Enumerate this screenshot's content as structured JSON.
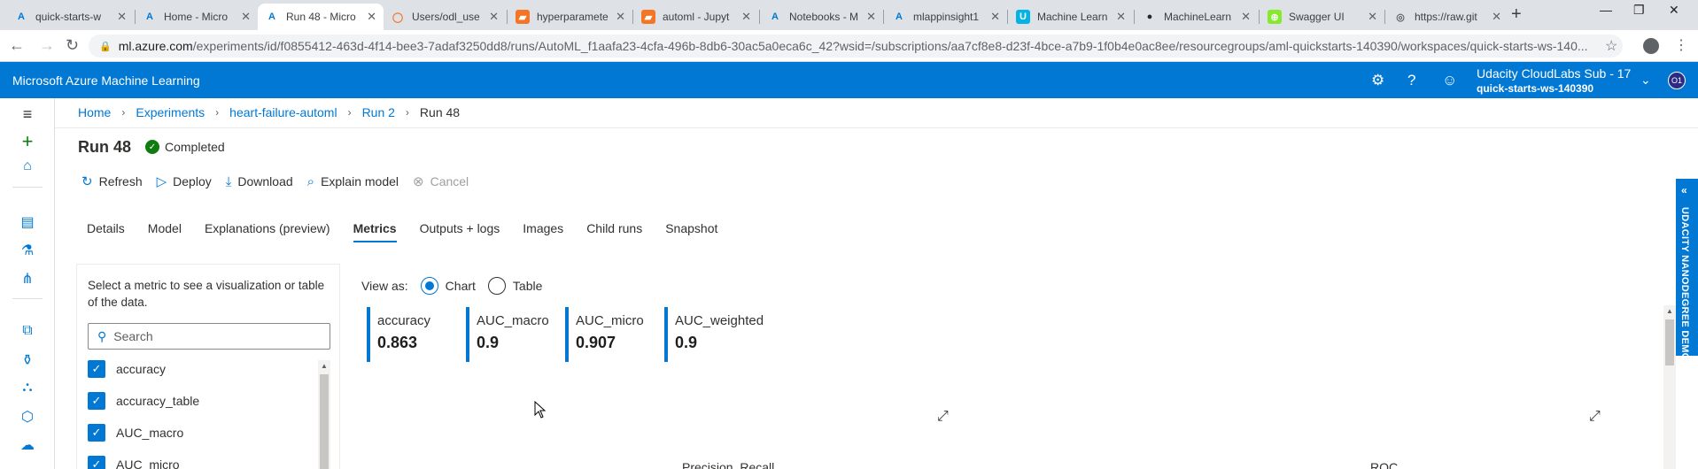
{
  "browser": {
    "tabs": [
      {
        "label": "quick-starts-w",
        "icon": "A",
        "color": "#0078d4",
        "bg": "transparent"
      },
      {
        "label": "Home - Micro",
        "icon": "A",
        "color": "#0078d4",
        "bg": "transparent"
      },
      {
        "label": "Run 48 - Micro",
        "icon": "A",
        "color": "#0078d4",
        "bg": "transparent"
      },
      {
        "label": "Users/odl_use",
        "icon": "◯",
        "color": "#f37626",
        "bg": "transparent"
      },
      {
        "label": "hyperparamete",
        "icon": "▰",
        "color": "#fff",
        "bg": "#f37626"
      },
      {
        "label": "automl - Jupyt",
        "icon": "▰",
        "color": "#fff",
        "bg": "#f37626"
      },
      {
        "label": "Notebooks - M",
        "icon": "A",
        "color": "#0078d4",
        "bg": "transparent"
      },
      {
        "label": "mlappinsight1",
        "icon": "A",
        "color": "#0078d4",
        "bg": "transparent"
      },
      {
        "label": "Machine Learn",
        "icon": "U",
        "color": "#fff",
        "bg": "#02b3e4"
      },
      {
        "label": "MachineLearn",
        "icon": "●",
        "color": "#24292e",
        "bg": "transparent"
      },
      {
        "label": "Swagger UI",
        "icon": "⊕",
        "color": "#fff",
        "bg": "#85ea2d"
      },
      {
        "label": "https://raw.git",
        "icon": "◎",
        "color": "#5f6368",
        "bg": "transparent"
      }
    ],
    "url_host": "ml.azure.com",
    "url_path": "/experiments/id/f0855412-463d-4f14-bee3-7adaf3250dd8/runs/AutoML_f1aafa23-4cfa-496b-8db6-30ac5a0eca6c_42?wsid=/subscriptions/aa7cf8e8-d23f-4bce-a7b9-1f0b4e0ac8ee/resourcegroups/aml-quickstarts-140390/workspaces/quick-starts-ws-140..."
  },
  "app": {
    "title": "Microsoft Azure Machine Learning",
    "subscription": "Udacity CloudLabs Sub - 17",
    "workspace": "quick-starts-ws-140390",
    "avatar": "O1"
  },
  "breadcrumb": [
    "Home",
    "Experiments",
    "heart-failure-automl",
    "Run 2",
    "Run 48"
  ],
  "run": {
    "title": "Run 48",
    "status": "Completed"
  },
  "toolbar": {
    "refresh": "Refresh",
    "deploy": "Deploy",
    "download": "Download",
    "explain": "Explain model",
    "cancel": "Cancel"
  },
  "tabs": [
    "Details",
    "Model",
    "Explanations (preview)",
    "Metrics",
    "Outputs + logs",
    "Images",
    "Child runs",
    "Snapshot"
  ],
  "metrics_panel": {
    "hint": "Select a metric to see a visualization or table of the data.",
    "search_placeholder": "Search",
    "items": [
      "accuracy",
      "accuracy_table",
      "AUC_macro",
      "AUC_micro"
    ]
  },
  "view_as": {
    "label": "View as:",
    "chart": "Chart",
    "table": "Table"
  },
  "metric_cards": [
    {
      "name": "accuracy",
      "value": "0.863"
    },
    {
      "name": "AUC_macro",
      "value": "0.9"
    },
    {
      "name": "AUC_micro",
      "value": "0.907"
    },
    {
      "name": "AUC_weighted",
      "value": "0.9"
    }
  ],
  "charts": {
    "left_title": "Precision_Recall",
    "right_title": "ROC"
  },
  "side_banner": "UDACITY NANODEGREE DEMO"
}
